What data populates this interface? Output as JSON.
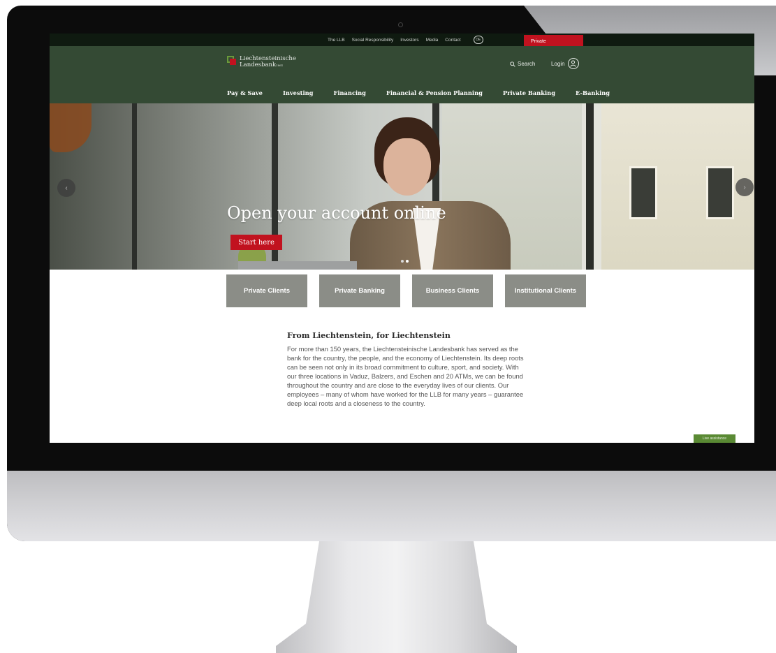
{
  "topbar": {
    "links": [
      "The LLB",
      "Social Responsibility",
      "Investors",
      "Media",
      "Contact"
    ],
    "language": "DE",
    "segment_tab": "Private"
  },
  "header": {
    "logo_line1": "Liechtensteinische",
    "logo_line2": "Landesbank",
    "logo_suffix": "1861",
    "search_label": "Search",
    "login_label": "Login"
  },
  "nav": {
    "items": [
      "Pay & Save",
      "Investing",
      "Financing",
      "Financial & Pension Planning",
      "Private Banking",
      "E-Banking"
    ]
  },
  "hero": {
    "title": "Open your account online",
    "cta": "Start here",
    "prev": "‹",
    "next": "›"
  },
  "segments": {
    "items": [
      "Private Clients",
      "Private Banking",
      "Business Clients",
      "Institutional Clients"
    ]
  },
  "content": {
    "title": "From Liechtenstein, for Liechtenstein",
    "body": "For more than 150 years, the Liechtensteinische Landesbank has served as the bank for the country, the people, and the economy of Liechtenstein. Its deep roots can be seen not only in its broad commitment to culture, sport, and society. With our three locations in Vaduz, Balzers, and Eschen and 20 ATMs, we can be found throughout the country and are close to the everyday lives of our clients. Our employees – many of whom have worked for the LLB for many years – guarantee deep local roots and a closeness to the country."
  },
  "help_button": "Live assistance",
  "colors": {
    "brand_green": "#344a34",
    "accent_red": "#c1121f",
    "segment_gray": "#8b8d87"
  }
}
